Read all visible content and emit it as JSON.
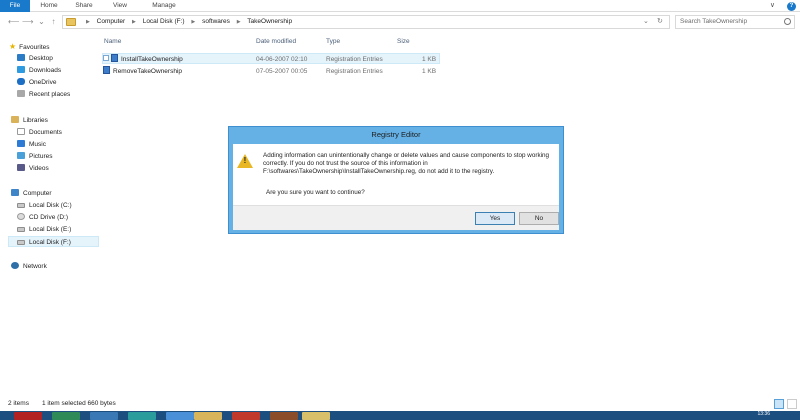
{
  "ribbon": {
    "tabs": [
      "File",
      "Home",
      "Share",
      "View",
      "Manage"
    ],
    "right_chevron": "∨",
    "help": "?"
  },
  "address": {
    "path": [
      "Computer",
      "Local Disk (F:)",
      "softwares",
      "TakeOwnership"
    ],
    "search_placeholder": "Search TakeOwnership"
  },
  "nav": {
    "favourites": {
      "label": "Favourites",
      "items": [
        "Desktop",
        "Downloads",
        "OneDrive",
        "Recent places"
      ]
    },
    "libraries": {
      "label": "Libraries",
      "items": [
        "Documents",
        "Music",
        "Pictures",
        "Videos"
      ]
    },
    "computer": {
      "label": "Computer",
      "items": [
        "Local Disk (C:)",
        "CD Drive (D:)",
        "Local Disk (E:)",
        "Local Disk (F:)"
      ]
    },
    "network": {
      "label": "Network"
    }
  },
  "files": {
    "columns": [
      "Name",
      "Date modified",
      "Type",
      "Size"
    ],
    "rows": [
      {
        "name": "InstallTakeOwnership",
        "date": "04-06-2007 02:10",
        "type": "Registration Entries",
        "size": "1 KB"
      },
      {
        "name": "RemoveTakeOwnership",
        "date": "07-05-2007 00:05",
        "type": "Registration Entries",
        "size": "1 KB"
      }
    ]
  },
  "dialog": {
    "title": "Registry Editor",
    "message": "Adding information can unintentionally change or delete values and cause components to stop working correctly. If you do not trust the source of this information in F:\\softwares\\TakeOwnership\\InstallTakeOwnership.reg, do not add it to the registry.",
    "question": "Are you sure you want to continue?",
    "yes": "Yes",
    "no": "No"
  },
  "status": {
    "items": "2 items",
    "selected": "1 item selected  660 bytes"
  },
  "taskbar": {
    "clock": "13:36"
  },
  "colors": {
    "accent": "#1979ca",
    "dialog_frame": "#65b1e6",
    "selection": "#e5f3fb",
    "taskbar": "#1c4e7f"
  }
}
